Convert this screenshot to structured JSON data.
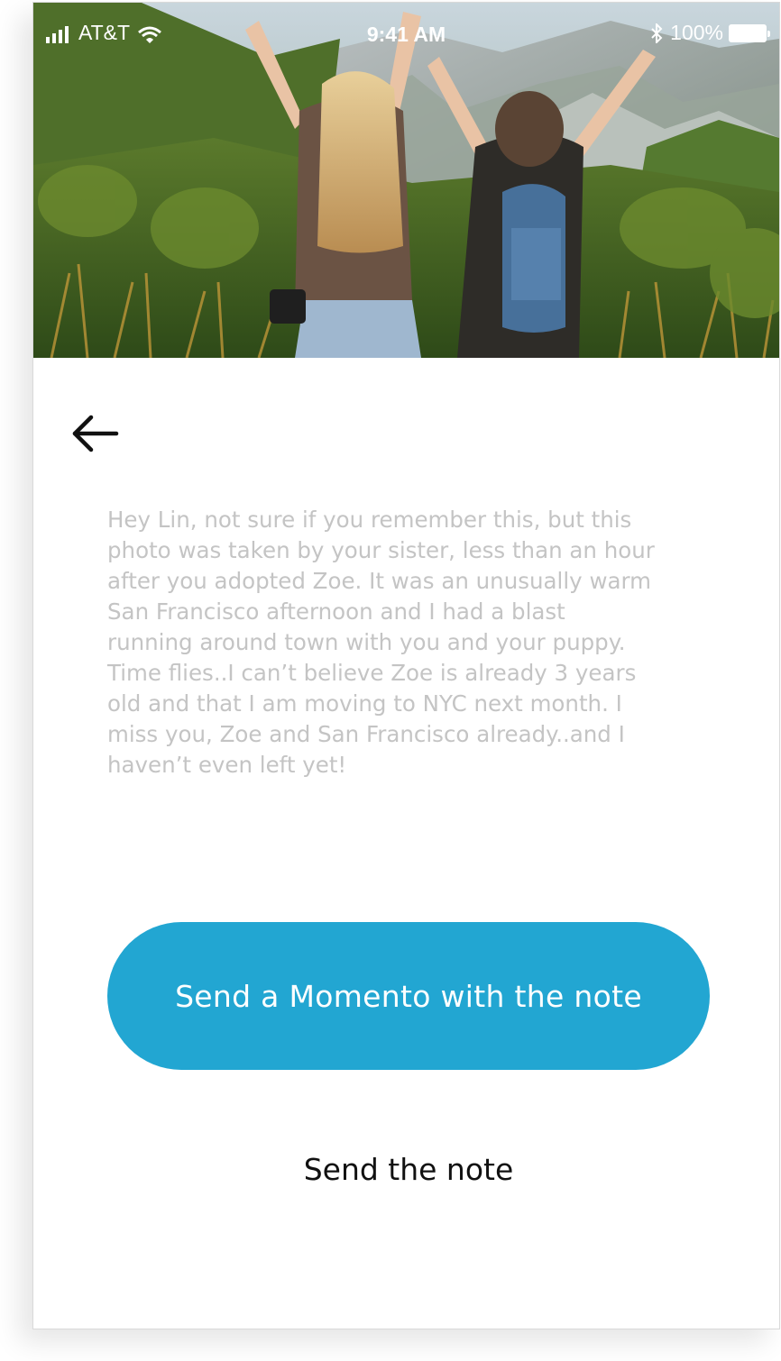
{
  "status_bar": {
    "carrier": "AT&T",
    "time": "9:41 AM",
    "battery": "100%",
    "icons": [
      "signal-icon",
      "wifi-icon",
      "bluetooth-icon",
      "battery-icon"
    ]
  },
  "hero": {
    "image": "photo of two women with raised arms on a green hillside",
    "icon": "photo"
  },
  "nav": {
    "back_icon": "arrow-left-icon"
  },
  "note": {
    "text": "Hey Lin, not sure if you remember this, but this\nphoto was taken by your sister, less than an hour\nafter you adopted Zoe. It was an unusually warm\nSan Francisco afternoon and I had a blast\nrunning around town with you and your puppy.\nTime flies..I can’t believe Zoe is already 3 years\nold and that I am moving to NYC next month. I\nmiss you, Zoe and San Francisco already..and I\nhaven’t even left yet!"
  },
  "actions": {
    "primary_label": "Send a Momento with the note",
    "secondary_label": "Send the note"
  },
  "colors": {
    "primary": "#22a6d2",
    "note_text": "#c4c4c4"
  }
}
